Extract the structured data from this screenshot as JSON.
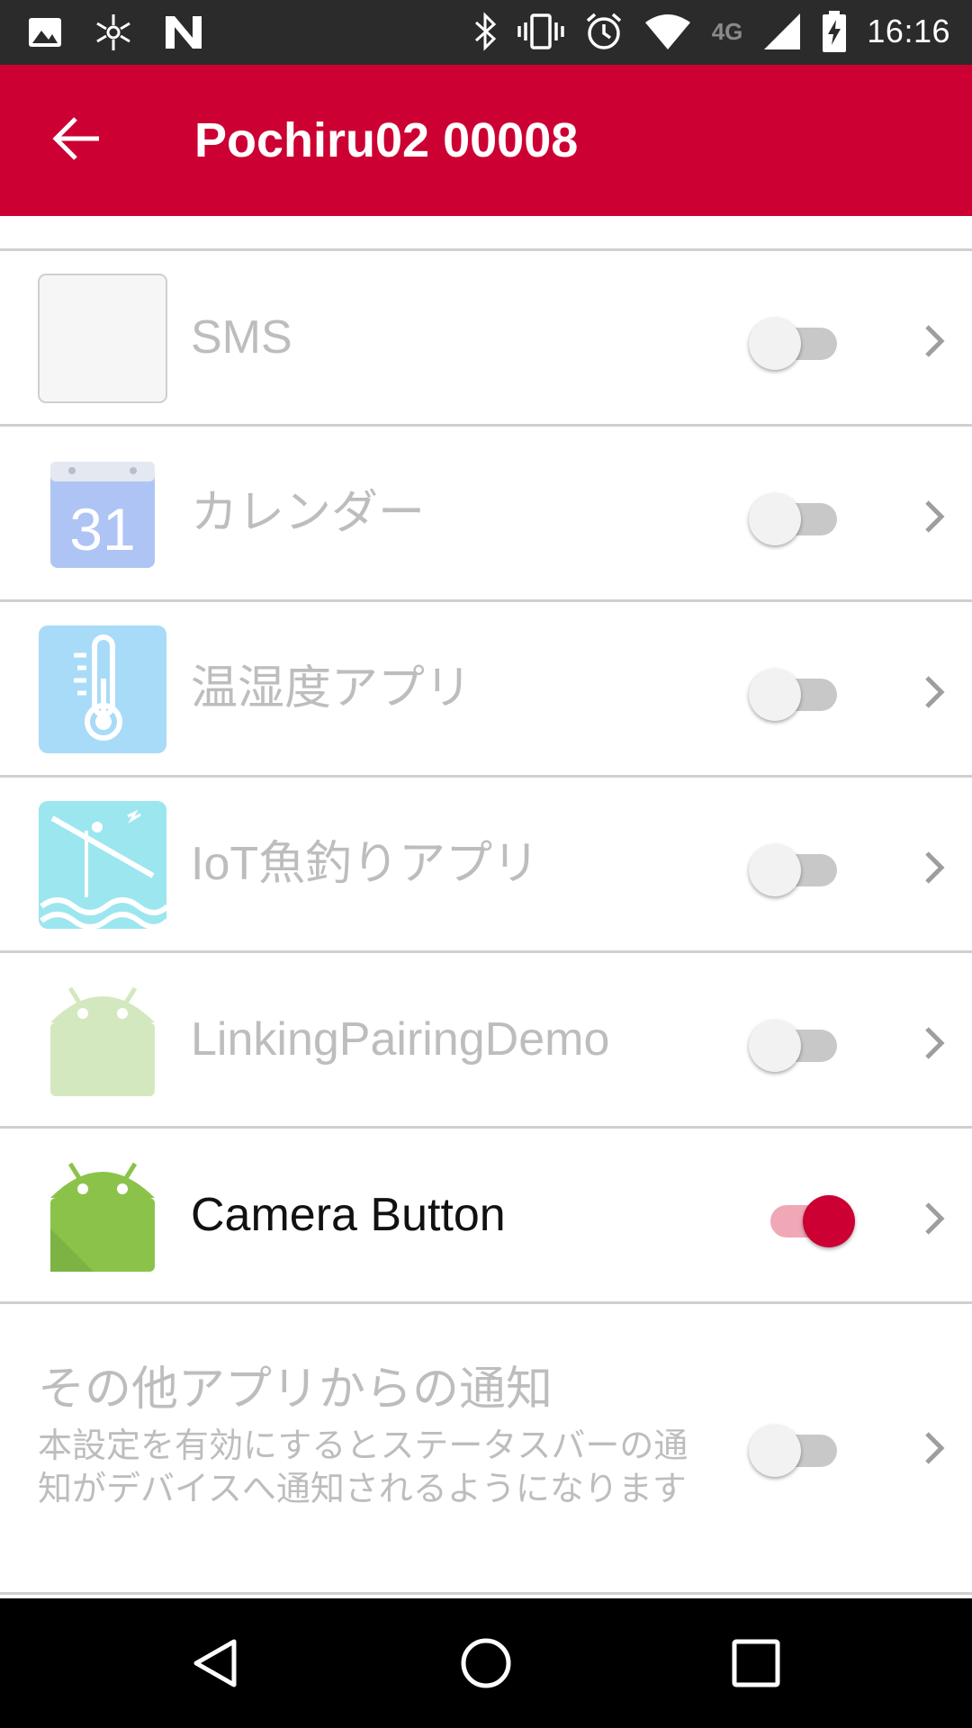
{
  "status_bar": {
    "time": "16:16",
    "network_label": "4G",
    "icons": [
      "image-icon",
      "network-hub-icon",
      "n-icon",
      "bluetooth-icon",
      "vibrate-icon",
      "alarm-icon",
      "wifi-icon",
      "signal-icon",
      "battery-charging-icon"
    ]
  },
  "app_bar": {
    "title": "Pochiru02 00008"
  },
  "apps": [
    {
      "label": "SMS",
      "enabled": false,
      "icon": "sms-app-icon"
    },
    {
      "label": "カレンダー",
      "enabled": false,
      "icon": "calendar-app-icon",
      "icon_text": "31"
    },
    {
      "label": "温湿度アプリ",
      "enabled": false,
      "icon": "thermometer-app-icon"
    },
    {
      "label": "IoT魚釣りアプリ",
      "enabled": false,
      "icon": "fishing-app-icon"
    },
    {
      "label": "LinkingPairingDemo",
      "enabled": false,
      "icon": "android-app-icon"
    },
    {
      "label": "Camera Button",
      "enabled": true,
      "icon": "android-app-icon"
    }
  ],
  "other_notifications": {
    "title": "その他アプリからの通知",
    "description": "本設定を有効にするとステータスバーの通知がデバイスへ通知されるようになります",
    "enabled": false
  },
  "colors": {
    "accent": "#cc0033",
    "statusbar": "#2b2b2b",
    "disabled_text": "#bdbdbd"
  }
}
